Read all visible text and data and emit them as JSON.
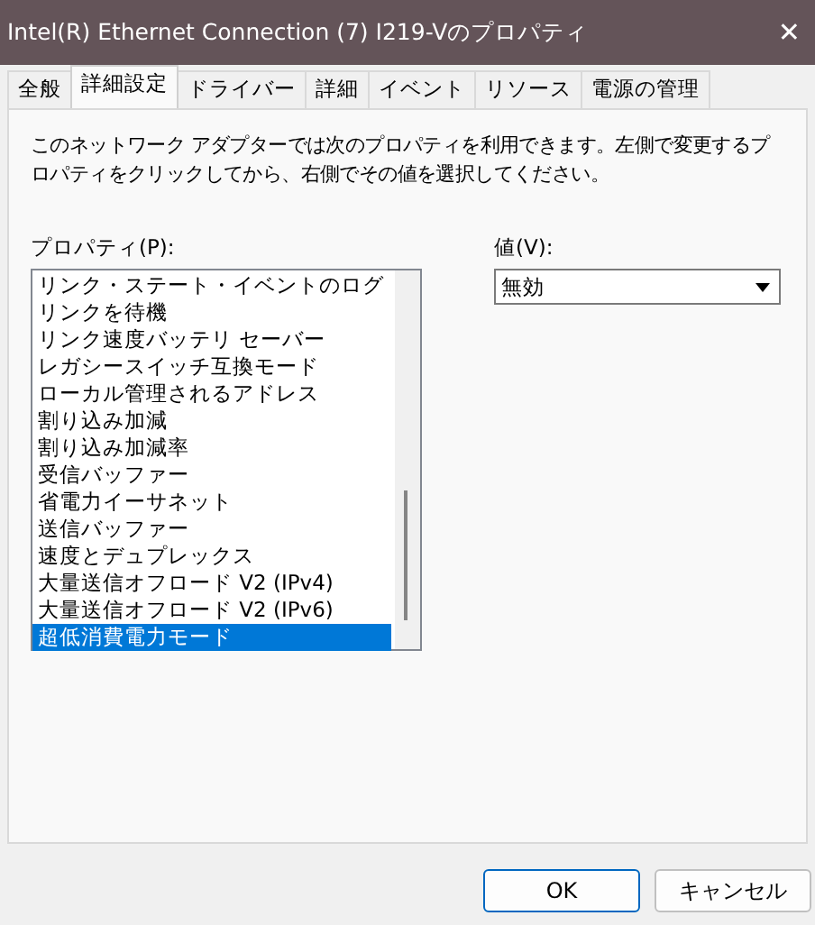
{
  "window": {
    "title": "Intel(R) Ethernet Connection (7) I219-Vのプロパティ",
    "close": "✕"
  },
  "tabs": [
    {
      "label": "全般",
      "selected": false
    },
    {
      "label": "詳細設定",
      "selected": true
    },
    {
      "label": "ドライバー",
      "selected": false
    },
    {
      "label": "詳細",
      "selected": false
    },
    {
      "label": "イベント",
      "selected": false
    },
    {
      "label": "リソース",
      "selected": false
    },
    {
      "label": "電源の管理",
      "selected": false
    }
  ],
  "description": "このネットワーク アダプターでは次のプロパティを利用できます。左側で変更するプロパティをクリックしてから、右側でその値を選択してください。",
  "property_label": "プロパティ(P):",
  "properties": [
    {
      "label": "リンク・ステート・イベントのログ",
      "selected": false
    },
    {
      "label": "リンクを待機",
      "selected": false
    },
    {
      "label": "リンク速度バッテリ セーバー",
      "selected": false
    },
    {
      "label": "レガシースイッチ互換モード",
      "selected": false
    },
    {
      "label": "ローカル管理されるアドレス",
      "selected": false
    },
    {
      "label": "割り込み加減",
      "selected": false
    },
    {
      "label": "割り込み加減率",
      "selected": false
    },
    {
      "label": "受信バッファー",
      "selected": false
    },
    {
      "label": "省電力イーサネット",
      "selected": false
    },
    {
      "label": "送信バッファー",
      "selected": false
    },
    {
      "label": "速度とデュプレックス",
      "selected": false
    },
    {
      "label": "大量送信オフロード V2 (IPv4)",
      "selected": false
    },
    {
      "label": "大量送信オフロード V2 (IPv6)",
      "selected": false
    },
    {
      "label": "超低消費電力モード",
      "selected": true
    }
  ],
  "value_label": "値(V):",
  "value": "無効",
  "buttons": [
    {
      "label": "OK",
      "default": true
    },
    {
      "label": "キャンセル",
      "default": false
    }
  ]
}
